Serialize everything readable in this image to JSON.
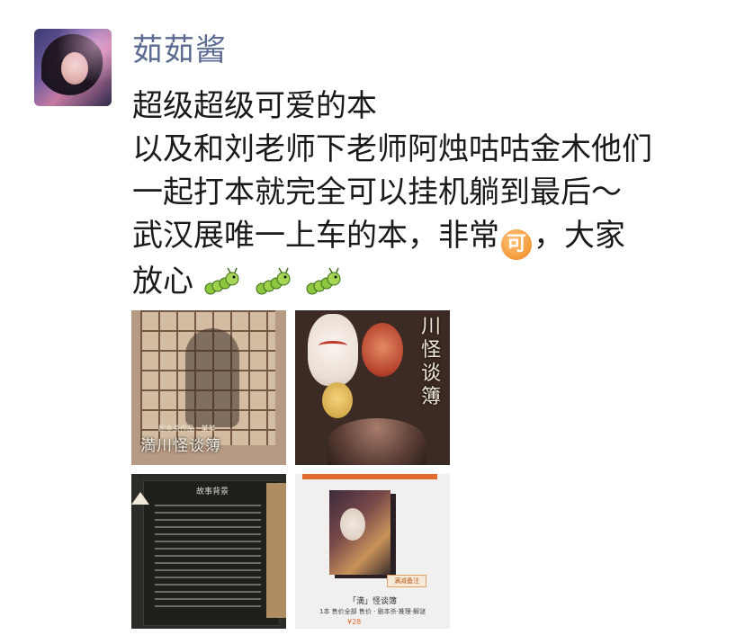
{
  "author": {
    "name": "茹茹酱"
  },
  "post": {
    "lines": [
      "超级超级可爱的本",
      "以及和刘老师下老师阿烛咕咕金木他们",
      "一起打本就完全可以挂机躺到最后～",
      "武汉展唯一上车的本，非常",
      "，大家",
      "放心"
    ],
    "emoji_ke": "可"
  },
  "photos": [
    {
      "title": "満川怪谈簿",
      "subtitle": "剧本杀作品 · 某某"
    },
    {
      "vertical_text": "川怪谈簿"
    },
    {
      "heading": "故事背景"
    },
    {
      "badge": "满减备注",
      "title": "「満」怪谈簿",
      "desc": "1本 售价全部 售价 · 剧本杀·推理·解谜",
      "price": "¥28"
    }
  ]
}
